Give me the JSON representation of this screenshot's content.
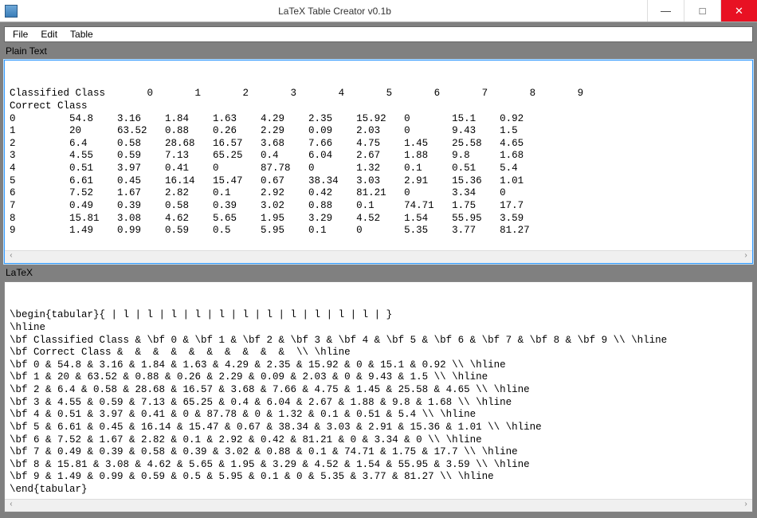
{
  "window": {
    "title": "LaTeX Table Creator v0.1b",
    "minimize": "—",
    "maximize": "□",
    "close": "✕"
  },
  "menubar": {
    "file": "File",
    "edit": "Edit",
    "table": "Table"
  },
  "labels": {
    "plain": "Plain Text",
    "latex": "LaTeX"
  },
  "plain_text": "Classified Class       0       1       2       3       4       5       6       7       8       9\nCorrect Class\n0         54.8    3.16    1.84    1.63    4.29    2.35    15.92   0       15.1    0.92\n1         20      63.52   0.88    0.26    2.29    0.09    2.03    0       9.43    1.5\n2         6.4     0.58    28.68   16.57   3.68    7.66    4.75    1.45    25.58   4.65\n3         4.55    0.59    7.13    65.25   0.4     6.04    2.67    1.88    9.8     1.68\n4         0.51    3.97    0.41    0       87.78   0       1.32    0.1     0.51    5.4\n5         6.61    0.45    16.14   15.47   0.67    38.34   3.03    2.91    15.36   1.01\n6         7.52    1.67    2.82    0.1     2.92    0.42    81.21   0       3.34    0\n7         0.49    0.39    0.58    0.39    3.02    0.88    0.1     74.71   1.75    17.7\n8         15.81   3.08    4.62    5.65    1.95    3.29    4.52    1.54    55.95   3.59\n9         1.49    0.99    0.59    0.5     5.95    0.1     0       5.35    3.77    81.27",
  "latex_text": "\\begin{tabular}{ | l | l | l | l | l | l | l | l | l | l | l | }\n\\hline\n\\bf Classified Class & \\bf 0 & \\bf 1 & \\bf 2 & \\bf 3 & \\bf 4 & \\bf 5 & \\bf 6 & \\bf 7 & \\bf 8 & \\bf 9 \\\\ \\hline\n\\bf Correct Class &  &  &  &  &  &  &  &  &  &  \\\\ \\hline\n\\bf 0 & 54.8 & 3.16 & 1.84 & 1.63 & 4.29 & 2.35 & 15.92 & 0 & 15.1 & 0.92 \\\\ \\hline\n\\bf 1 & 20 & 63.52 & 0.88 & 0.26 & 2.29 & 0.09 & 2.03 & 0 & 9.43 & 1.5 \\\\ \\hline\n\\bf 2 & 6.4 & 0.58 & 28.68 & 16.57 & 3.68 & 7.66 & 4.75 & 1.45 & 25.58 & 4.65 \\\\ \\hline\n\\bf 3 & 4.55 & 0.59 & 7.13 & 65.25 & 0.4 & 6.04 & 2.67 & 1.88 & 9.8 & 1.68 \\\\ \\hline\n\\bf 4 & 0.51 & 3.97 & 0.41 & 0 & 87.78 & 0 & 1.32 & 0.1 & 0.51 & 5.4 \\\\ \\hline\n\\bf 5 & 6.61 & 0.45 & 16.14 & 15.47 & 0.67 & 38.34 & 3.03 & 2.91 & 15.36 & 1.01 \\\\ \\hline\n\\bf 6 & 7.52 & 1.67 & 2.82 & 0.1 & 2.92 & 0.42 & 81.21 & 0 & 3.34 & 0 \\\\ \\hline\n\\bf 7 & 0.49 & 0.39 & 0.58 & 0.39 & 3.02 & 0.88 & 0.1 & 74.71 & 1.75 & 17.7 \\\\ \\hline\n\\bf 8 & 15.81 & 3.08 & 4.62 & 5.65 & 1.95 & 3.29 & 4.52 & 1.54 & 55.95 & 3.59 \\\\ \\hline\n\\bf 9 & 1.49 & 0.99 & 0.59 & 0.5 & 5.95 & 0.1 & 0 & 5.35 & 3.77 & 81.27 \\\\ \\hline\n\\end{tabular}",
  "scroll": {
    "left_arrow": "‹",
    "right_arrow": "›"
  },
  "chart_data": {
    "type": "table",
    "title": "Classified Class vs Correct Class",
    "columns": [
      "Correct Class",
      "0",
      "1",
      "2",
      "3",
      "4",
      "5",
      "6",
      "7",
      "8",
      "9"
    ],
    "rows": [
      [
        "0",
        54.8,
        3.16,
        1.84,
        1.63,
        4.29,
        2.35,
        15.92,
        0,
        15.1,
        0.92
      ],
      [
        "1",
        20,
        63.52,
        0.88,
        0.26,
        2.29,
        0.09,
        2.03,
        0,
        9.43,
        1.5
      ],
      [
        "2",
        6.4,
        0.58,
        28.68,
        16.57,
        3.68,
        7.66,
        4.75,
        1.45,
        25.58,
        4.65
      ],
      [
        "3",
        4.55,
        0.59,
        7.13,
        65.25,
        0.4,
        6.04,
        2.67,
        1.88,
        9.8,
        1.68
      ],
      [
        "4",
        0.51,
        3.97,
        0.41,
        0,
        87.78,
        0,
        1.32,
        0.1,
        0.51,
        5.4
      ],
      [
        "5",
        6.61,
        0.45,
        16.14,
        15.47,
        0.67,
        38.34,
        3.03,
        2.91,
        15.36,
        1.01
      ],
      [
        "6",
        7.52,
        1.67,
        2.82,
        0.1,
        2.92,
        0.42,
        81.21,
        0,
        3.34,
        0
      ],
      [
        "7",
        0.49,
        0.39,
        0.58,
        0.39,
        3.02,
        0.88,
        0.1,
        74.71,
        1.75,
        17.7
      ],
      [
        "8",
        15.81,
        3.08,
        4.62,
        5.65,
        1.95,
        3.29,
        4.52,
        1.54,
        55.95,
        3.59
      ],
      [
        "9",
        1.49,
        0.99,
        0.59,
        0.5,
        5.95,
        0.1,
        0,
        5.35,
        3.77,
        81.27
      ]
    ]
  }
}
